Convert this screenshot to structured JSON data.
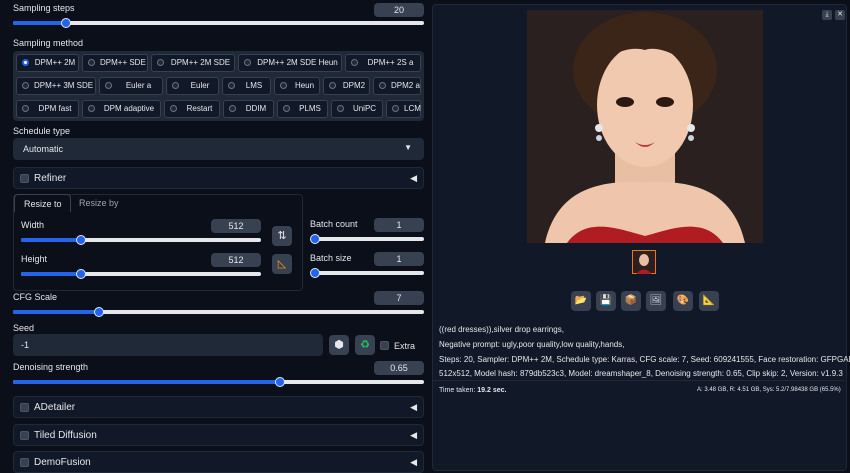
{
  "sampling_steps": {
    "label": "Sampling steps",
    "value": "20",
    "level": 0.13
  },
  "sampling_method": {
    "label": "Sampling method",
    "options": [
      "DPM++ 2M",
      "DPM++ SDE",
      "DPM++ 2M SDE",
      "DPM++ 2M SDE Heun",
      "DPM++ 2S a",
      "DPM++ 3M SDE",
      "Euler a",
      "Euler",
      "LMS",
      "Heun",
      "DPM2",
      "DPM2 a",
      "DPM fast",
      "DPM adaptive",
      "Restart",
      "DDIM",
      "PLMS",
      "UniPC",
      "LCM"
    ],
    "selected": "DPM++ 2M"
  },
  "schedule_type": {
    "label": "Schedule type",
    "value": "Automatic"
  },
  "refiner": {
    "label": "Refiner"
  },
  "size_tabs": {
    "active": "Resize to",
    "other": "Resize by"
  },
  "width": {
    "label": "Width",
    "value": "512",
    "level": 0.25
  },
  "height": {
    "label": "Height",
    "value": "512",
    "level": 0.25
  },
  "batch_count": {
    "label": "Batch count",
    "value": "1",
    "level": 0.0
  },
  "batch_size": {
    "label": "Batch size",
    "value": "1",
    "level": 0.0
  },
  "cfg_scale": {
    "label": "CFG Scale",
    "value": "7",
    "level": 0.21
  },
  "seed": {
    "label": "Seed",
    "value": "-1",
    "extra_label": "Extra"
  },
  "denoising": {
    "label": "Denoising strength",
    "value": "0.65",
    "level": 0.65
  },
  "accordions": [
    "ADetailer",
    "Tiled Diffusion",
    "DemoFusion"
  ],
  "info": {
    "prompt": "((red dresses)),silver drop earrings,",
    "negative": "Negative prompt: ugly,poor quality,low quality,hands,",
    "params_1": "Steps: 20, Sampler: DPM++ 2M, Schedule type: Karras, CFG scale: 7, Seed: 609241555, Face restoration: GFPGAN, Size:",
    "params_2": "512x512, Model hash: 879db523c3, Model: dreamshaper_8, Denoising strength: 0.65, Clip skip: 2, Version: v1.9.3"
  },
  "stats": {
    "time_label": "Time taken:",
    "time_value": "19.2 sec.",
    "memory": "A: 3.48 GB, R: 4.51 GB, Sys: 5.2/7.98438 GB (65.5%)"
  },
  "icons": [
    "download-icon",
    "close-icon",
    "swap-icon",
    "ratio-icon",
    "dice-icon",
    "recycle-icon",
    "folder-icon",
    "save-icon",
    "zip-icon",
    "image-icon",
    "palette-icon",
    "ruler-icon",
    "dropdown-caret-icon"
  ],
  "colors": {
    "accent": "#2563eb",
    "background": "#0b0f19",
    "panel": "#1f2937"
  }
}
